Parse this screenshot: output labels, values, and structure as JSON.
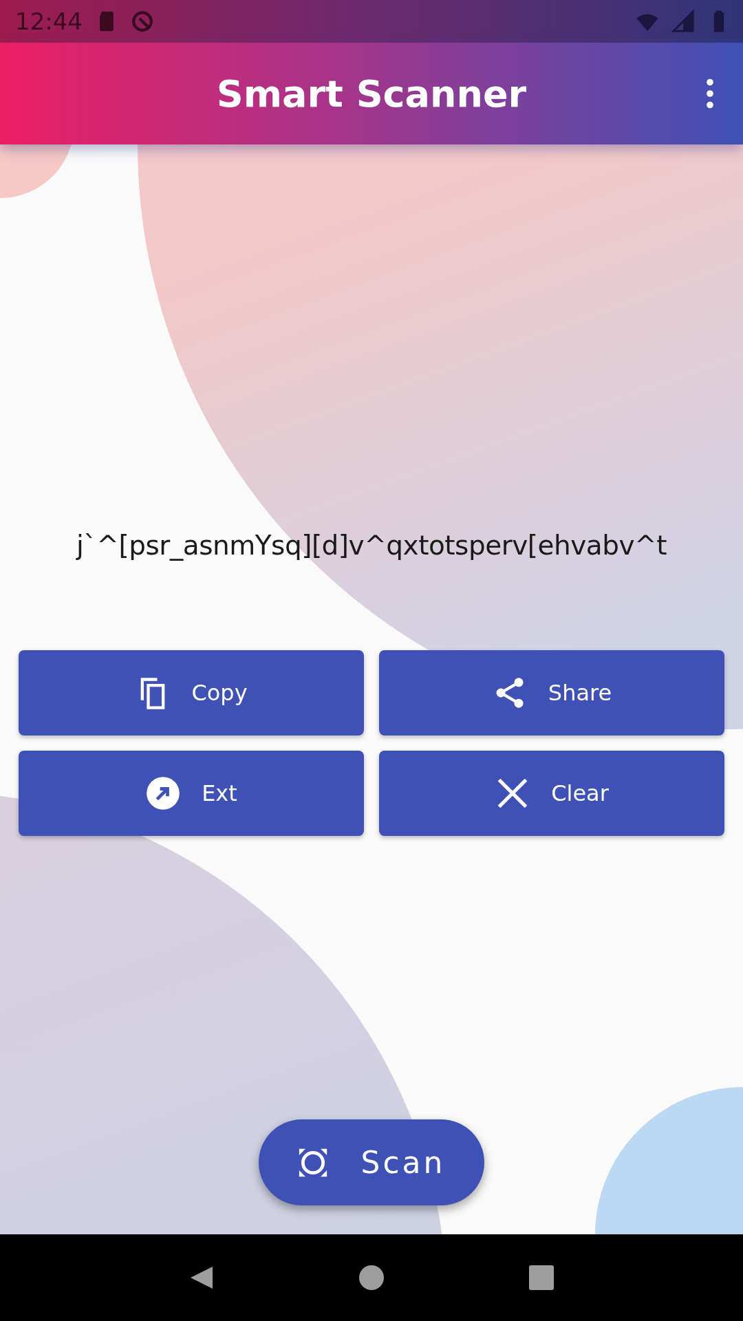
{
  "status_bar": {
    "time": "12:44"
  },
  "app_bar": {
    "title": "Smart Scanner"
  },
  "result": {
    "text": "j`^[psr_asnmYsq][d]v^qxtotsperv[ehvabv^t"
  },
  "actions": [
    {
      "label": "Copy"
    },
    {
      "label": "Share"
    },
    {
      "label": "Ext"
    },
    {
      "label": "Clear"
    }
  ],
  "scan_button": {
    "label": "Scan"
  }
}
